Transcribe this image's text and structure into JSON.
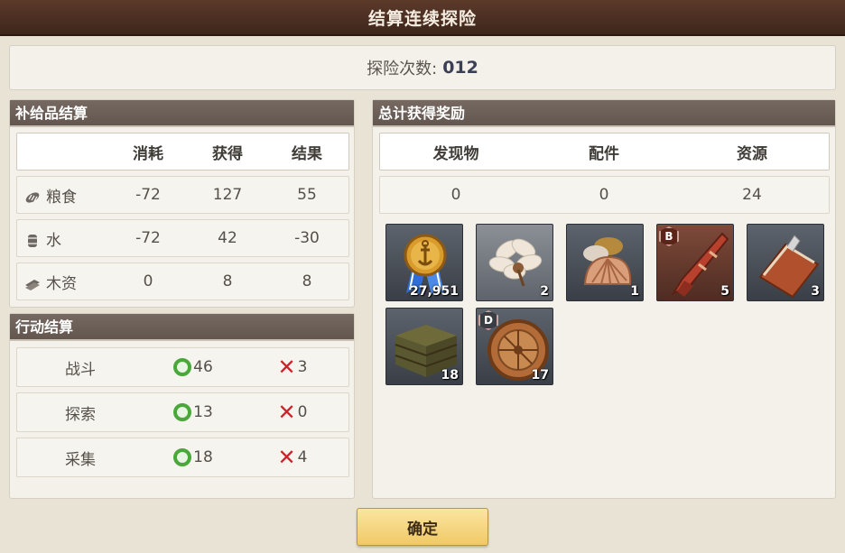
{
  "title": "结算连续探险",
  "expedition": {
    "label": "探险次数:",
    "count": "012"
  },
  "supply": {
    "heading": "补给品结算",
    "columns": [
      "消耗",
      "获得",
      "结果"
    ],
    "rows": [
      {
        "icon": "bread-icon",
        "name": "粮食",
        "consumed": "-72",
        "gained": "127",
        "result": "55"
      },
      {
        "icon": "water-barrel-icon",
        "name": "水",
        "consumed": "-72",
        "gained": "42",
        "result": "-30"
      },
      {
        "icon": "wood-planks-icon",
        "name": "木资",
        "consumed": "0",
        "gained": "8",
        "result": "8"
      }
    ]
  },
  "actions": {
    "heading": "行动结算",
    "rows": [
      {
        "name": "战斗",
        "success": "46",
        "fail": "3"
      },
      {
        "name": "探索",
        "success": "13",
        "fail": "0"
      },
      {
        "name": "采集",
        "success": "18",
        "fail": "4"
      }
    ]
  },
  "rewards": {
    "heading": "总计获得奖励",
    "columns": [
      "发现物",
      "配件",
      "资源"
    ],
    "values": [
      "0",
      "0",
      "24"
    ],
    "items": [
      {
        "icon": "anchor-medal-icon",
        "qty": "27,951",
        "badge": ""
      },
      {
        "icon": "feather-icon",
        "qty": "2",
        "badge": ""
      },
      {
        "icon": "seashell-icon",
        "qty": "1",
        "badge": ""
      },
      {
        "icon": "red-telescope-icon",
        "qty": "5",
        "badge": "B"
      },
      {
        "icon": "logbook-icon",
        "qty": "3",
        "badge": ""
      },
      {
        "icon": "wooden-crate-icon",
        "qty": "18",
        "badge": ""
      },
      {
        "icon": "astrolabe-icon",
        "qty": "17",
        "badge": "D"
      }
    ]
  },
  "confirm_label": "确定"
}
